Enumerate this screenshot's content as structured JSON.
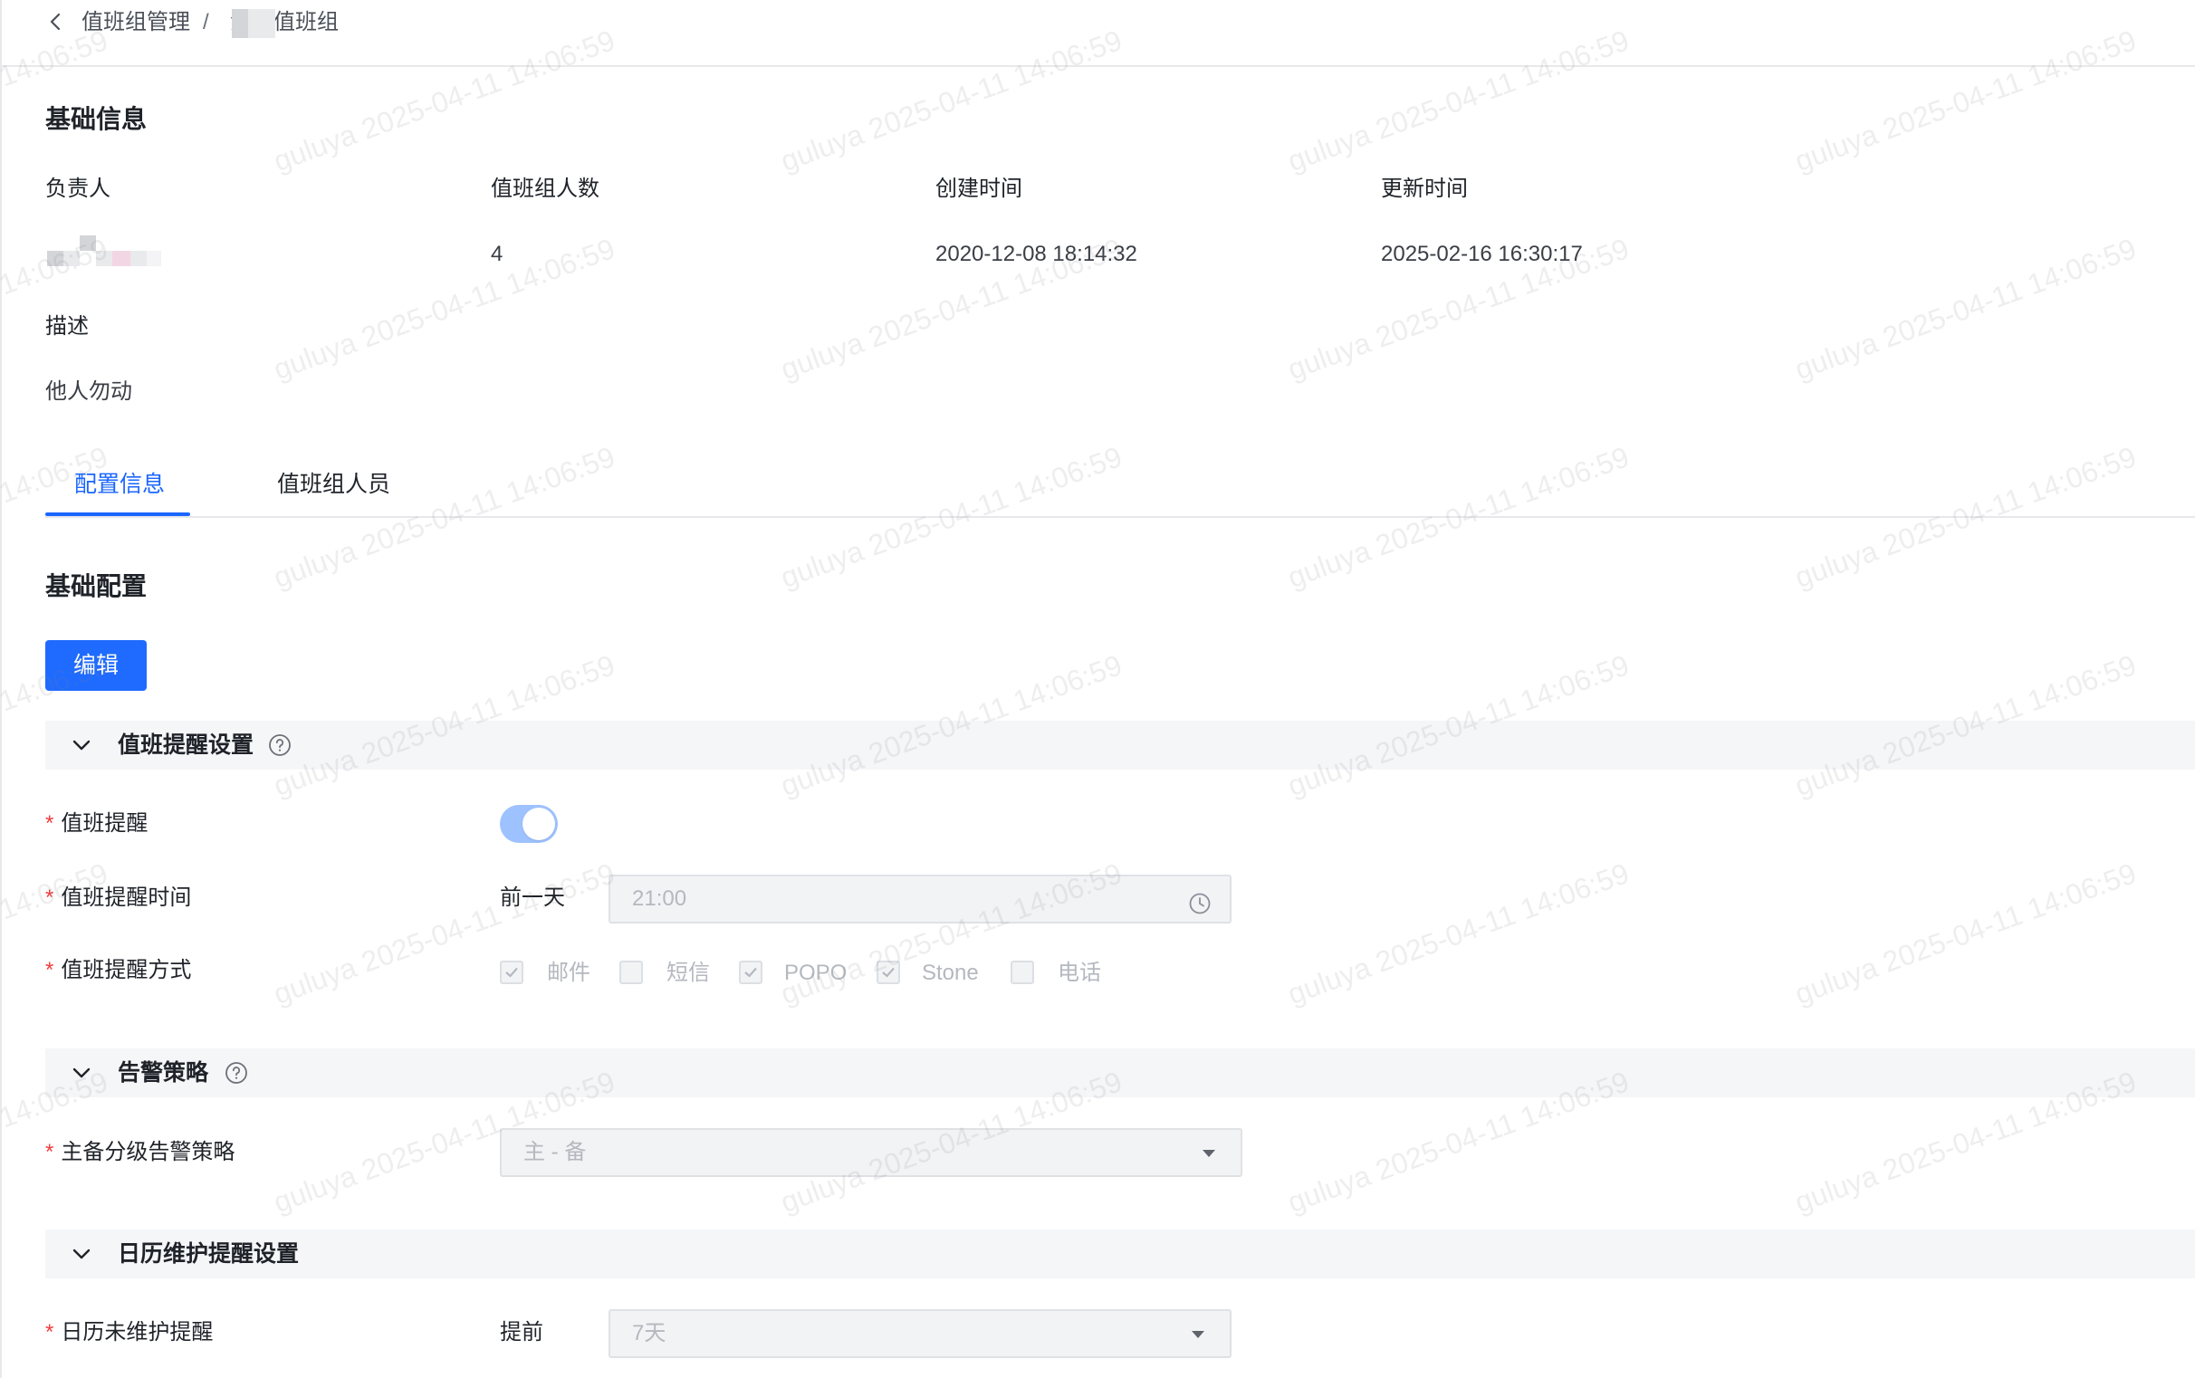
{
  "breadcrumb": {
    "parent": "值班组管理",
    "separator": "/",
    "current": "演示值班组"
  },
  "basic_info": {
    "title": "基础信息",
    "fields": {
      "owner_label": "负责人",
      "members_label": "值班组人数",
      "members_value": "4",
      "created_label": "创建时间",
      "created_value": "2020-12-08 18:14:32",
      "updated_label": "更新时间",
      "updated_value": "2025-02-16 16:30:17",
      "desc_label": "描述",
      "desc_value": "他人勿动"
    }
  },
  "tabs": [
    {
      "label": "配置信息",
      "active": true
    },
    {
      "label": "值班组人员",
      "active": false
    }
  ],
  "config": {
    "title": "基础配置",
    "edit_button": "编辑"
  },
  "panels": {
    "reminder": {
      "title": "值班提醒设置",
      "switch_label": "值班提醒",
      "switch_on": true,
      "time_label": "值班提醒时间",
      "time_prefix": "前一天",
      "time_value": "21:00",
      "method_label": "值班提醒方式",
      "methods": [
        {
          "label": "邮件",
          "checked": true
        },
        {
          "label": "短信",
          "checked": false
        },
        {
          "label": "POPO",
          "checked": true
        },
        {
          "label": "Stone",
          "checked": true
        },
        {
          "label": "电话",
          "checked": false
        }
      ]
    },
    "alert": {
      "title": "告警策略",
      "policy_label": "主备分级告警策略",
      "policy_value": "主 - 备"
    },
    "calendar": {
      "title": "日历维护提醒设置",
      "remind_label": "日历未维护提醒",
      "remind_prefix": "提前",
      "remind_value": "7天"
    }
  },
  "watermark": "guluya 2025-04-11 14:06:59",
  "colors": {
    "primary": "#1f6bff",
    "required": "#f23c3c",
    "panel_bg": "#f5f6f8"
  }
}
